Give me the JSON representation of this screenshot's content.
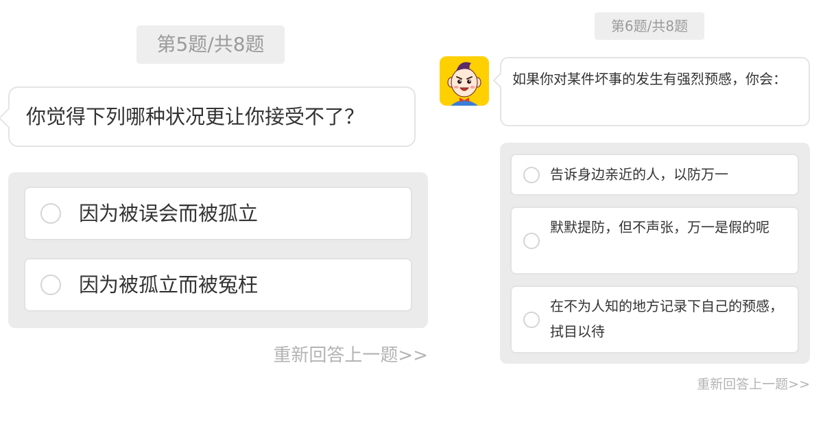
{
  "left": {
    "progress": "第5题/共8题",
    "question": "你觉得下列哪种状况更让你接受不了？",
    "options": [
      {
        "label": "因为被误会而被孤立"
      },
      {
        "label": "因为被孤立而被冤枉"
      }
    ],
    "reanswer": "重新回答上一题>>"
  },
  "right": {
    "progress": "第6题/共8题",
    "avatar_icon": "cartoon-boy-avatar-icon",
    "question": "如果你对某件坏事的发生有强烈预感，你会：",
    "options": [
      {
        "label": "告诉身边亲近的人，以防万一"
      },
      {
        "label": "默默提防，但不声张，万一是假的呢"
      },
      {
        "label": "在不为人知的地方记录下自己的预感，拭目以待"
      }
    ],
    "reanswer": "重新回答上一题>>"
  },
  "colors": {
    "panel_bg": "#ebebeb",
    "progress_bg": "#eeeeee",
    "muted_text": "#9a9a9a",
    "link_text": "#b3b3b3",
    "avatar_bg": "#ffd000"
  }
}
